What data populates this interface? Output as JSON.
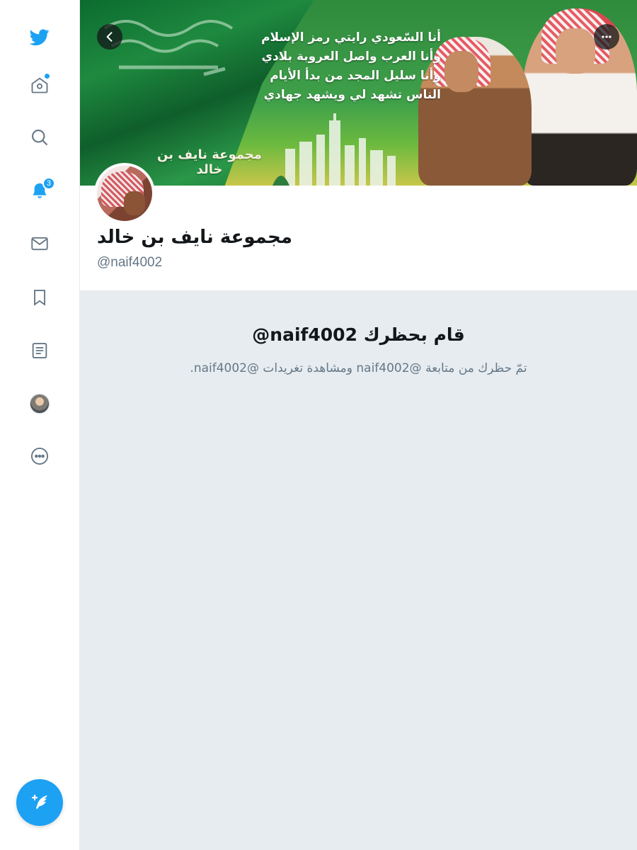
{
  "sidebar": {
    "items": [
      {
        "name": "twitter-logo-icon"
      },
      {
        "name": "home-icon",
        "has_dot": true
      },
      {
        "name": "search-icon"
      },
      {
        "name": "notifications-icon",
        "badge": "3"
      },
      {
        "name": "messages-icon"
      },
      {
        "name": "bookmarks-icon"
      },
      {
        "name": "lists-icon"
      },
      {
        "name": "profile-avatar-icon"
      },
      {
        "name": "more-icon"
      }
    ],
    "compose_icon": "compose-tweet-icon"
  },
  "banner": {
    "poem_lines": [
      "أنا السّعودي رايتي رمز الإسلام",
      "وأنا العرب واصل العروبة بلادي",
      "وأنا سليل المجد من بدأ الأيام",
      "الناس تشهد لي ويشهد جهادي"
    ],
    "group_text": "مجموعة نايف بن خالد"
  },
  "profile": {
    "display_name": "مجموعة نايف بن خالد",
    "handle": "@naif4002"
  },
  "blocked": {
    "title": "@naif4002 قام بحظرك",
    "description": "تمّ حظرك من متابعة @naif4002 ومشاهدة تغريدات @naif4002."
  },
  "colors": {
    "accent": "#1da1f2",
    "text_primary": "#14171a",
    "text_secondary": "#657786",
    "background": "#e6ecf0"
  }
}
